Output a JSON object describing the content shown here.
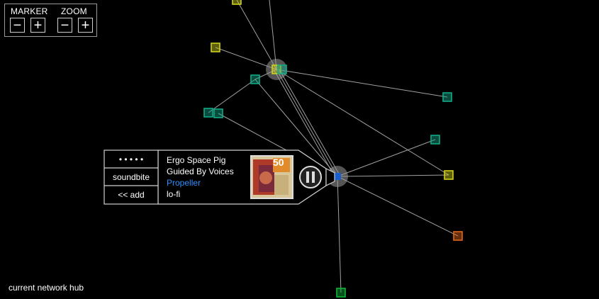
{
  "controls": {
    "marker_label": "MARKER",
    "zoom_label": "ZOOM",
    "minus_glyph": "−",
    "plus_glyph": "+"
  },
  "popup": {
    "rating_dots": "• • • • •",
    "soundbite_label": "soundbite",
    "add_label": "<<  add",
    "track_title": "Ergo Space Pig",
    "artist": "Guided By Voices",
    "album": "Propeller",
    "genre": "lo-fi",
    "album_art_badge": "50",
    "link_color": "#2f8fff"
  },
  "status_text": "current network hub",
  "colors": {
    "edge": "#bdbdbd",
    "node_yellow": "#cfd21a",
    "node_teal": "#12a987",
    "node_green": "#0fb53a",
    "node_orange": "#e0661a"
  }
}
